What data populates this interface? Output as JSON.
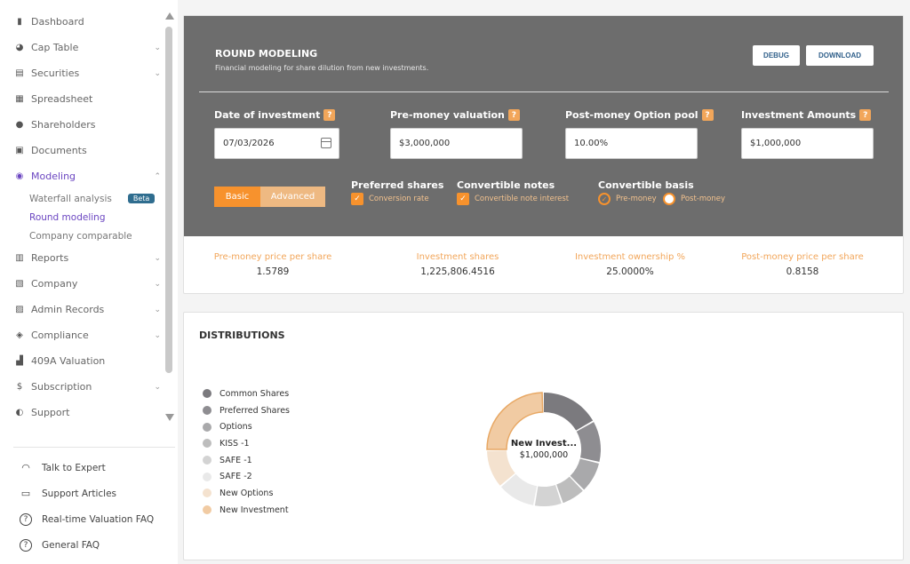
{
  "sidebar": {
    "items": [
      {
        "label": "Dashboard",
        "icon": "dashboard-icon",
        "has_chevron": false
      },
      {
        "label": "Cap Table",
        "icon": "pie-chart-icon",
        "has_chevron": true
      },
      {
        "label": "Securities",
        "icon": "document-icon",
        "has_chevron": true
      },
      {
        "label": "Spreadsheet",
        "icon": "spreadsheet-icon",
        "has_chevron": false
      },
      {
        "label": "Shareholders",
        "icon": "user-icon",
        "has_chevron": false
      },
      {
        "label": "Documents",
        "icon": "folder-icon",
        "has_chevron": false
      },
      {
        "label": "Modeling",
        "icon": "lightbulb-icon",
        "has_chevron": true,
        "active": true
      }
    ],
    "modeling_sub": [
      {
        "label": "Waterfall analysis",
        "badge": "Beta"
      },
      {
        "label": "Round modeling",
        "active": true
      },
      {
        "label": "Company comparable"
      }
    ],
    "items_after": [
      {
        "label": "Reports",
        "icon": "report-icon"
      },
      {
        "label": "Company",
        "icon": "building-icon"
      },
      {
        "label": "Admin Records",
        "icon": "records-icon"
      },
      {
        "label": "Compliance",
        "icon": "shield-icon"
      },
      {
        "label": "409A Valuation",
        "icon": "bar-chart-icon",
        "no_chevron": true
      },
      {
        "label": "Subscription",
        "icon": "dollar-icon"
      },
      {
        "label": "Support",
        "icon": "support-icon",
        "no_chevron": true
      }
    ],
    "help": [
      {
        "label": "Talk to Expert",
        "icon": "headset-icon"
      },
      {
        "label": "Support Articles",
        "icon": "book-icon"
      },
      {
        "label": "Real-time Valuation FAQ",
        "icon": "question-icon"
      },
      {
        "label": "General FAQ",
        "icon": "question-icon"
      }
    ]
  },
  "round": {
    "title": "ROUND MODELING",
    "subtitle": "Financial modeling for share dilution from new investments.",
    "debug_label": "DEBUG",
    "download_label": "DOWNLOAD",
    "fields": {
      "date_label": "Date of investment",
      "date_value": "07/03/2026",
      "pre_label": "Pre-money valuation",
      "pre_value": "$3,000,000",
      "pool_label": "Post-money Option pool",
      "pool_value": "10.00%",
      "amount_label": "Investment Amounts",
      "amount_value": "$1,000,000",
      "help_glyph": "?"
    },
    "toggle": {
      "basic": "Basic",
      "advanced": "Advanced"
    },
    "preferred": {
      "title": "Preferred shares",
      "option": "Conversion rate"
    },
    "notes": {
      "title": "Convertible notes",
      "option": "Convertible note interest"
    },
    "basis": {
      "title": "Convertible basis",
      "pre": "Pre-money",
      "post": "Post-money"
    },
    "metrics": {
      "pps_label": "Pre-money price per share",
      "pps_value": "1.5789",
      "shares_label": "Investment shares",
      "shares_value": "1,225,806.4516",
      "own_label": "Investment ownership %",
      "own_value": "25.0000%",
      "post_label": "Post-money price per share",
      "post_value": "0.8158"
    }
  },
  "distributions": {
    "title": "DISTRIBUTIONS",
    "center_label": "New Invest...",
    "center_value": "$1,000,000"
  },
  "chart_data": {
    "type": "pie",
    "title": "DISTRIBUTIONS",
    "donut": true,
    "series": [
      {
        "name": "Common Shares",
        "value": 17,
        "color": "#7b7a7e"
      },
      {
        "name": "Preferred Shares",
        "value": 12,
        "color": "#8e8d91"
      },
      {
        "name": "Options",
        "value": 9,
        "color": "#a9a9ab"
      },
      {
        "name": "KISS -1",
        "value": 7,
        "color": "#bdbdbd"
      },
      {
        "name": "SAFE -1",
        "value": 8,
        "color": "#d3d3d3"
      },
      {
        "name": "SAFE -2",
        "value": 11,
        "color": "#e9e9e9"
      },
      {
        "name": "New Options",
        "value": 11,
        "color": "#f4e2cf"
      },
      {
        "name": "New Investment",
        "value": 25,
        "color": "#f1cba3"
      }
    ]
  }
}
